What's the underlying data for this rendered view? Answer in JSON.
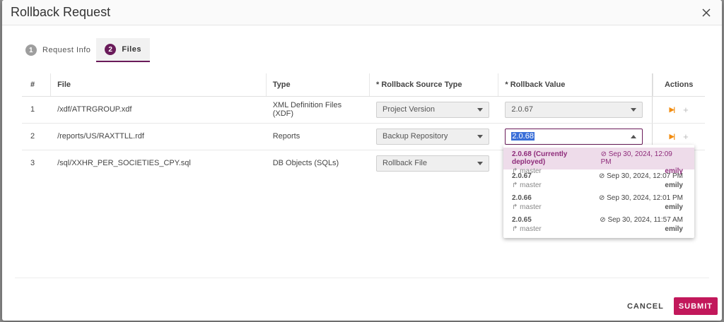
{
  "dialog": {
    "title": "Rollback Request",
    "close_icon": "close-icon"
  },
  "tabs": [
    {
      "step": "1",
      "label": "Request Info",
      "active": false
    },
    {
      "step": "2",
      "label": "Files",
      "active": true
    }
  ],
  "table": {
    "headers": {
      "num": "#",
      "file": "File",
      "type": "Type",
      "source": "* Rollback Source Type",
      "value": "* Rollback Value",
      "actions": "Actions"
    },
    "rows": [
      {
        "num": "1",
        "file": "/xdf/ATTRGROUP.xdf",
        "type": "XML Definition Files (XDF)",
        "source": "Project Version",
        "value": "2.0.67"
      },
      {
        "num": "2",
        "file": "/reports/US/RAXTTLL.rdf",
        "type": "Reports",
        "source": "Backup Repository",
        "value": "2.0.68"
      },
      {
        "num": "3",
        "file": "/sql/XXHR_PER_SOCIETIES_CPY.sql",
        "type": "DB Objects (SQLs)",
        "source": "Rollback File",
        "value": ""
      }
    ]
  },
  "dropdown": {
    "options": [
      {
        "version": "2.0.68 (Currently deployed)",
        "branch": "master",
        "date": "Sep 30, 2024, 12:09 PM",
        "user": "emily",
        "current": true
      },
      {
        "version": "2.0.67",
        "branch": "master",
        "date": "Sep 30, 2024, 12:07 PM",
        "user": "emily",
        "current": false
      },
      {
        "version": "2.0.66",
        "branch": "master",
        "date": "Sep 30, 2024, 12:01 PM",
        "user": "emily",
        "current": false
      },
      {
        "version": "2.0.65",
        "branch": "master",
        "date": "Sep 30, 2024, 11:57 AM",
        "user": "emily",
        "current": false
      }
    ]
  },
  "footer": {
    "cancel_label": "CANCEL",
    "submit_label": "SUBMIT"
  },
  "colors": {
    "accent": "#6a1b5a",
    "submit": "#c2185b",
    "action_icon": "#f28c10"
  }
}
